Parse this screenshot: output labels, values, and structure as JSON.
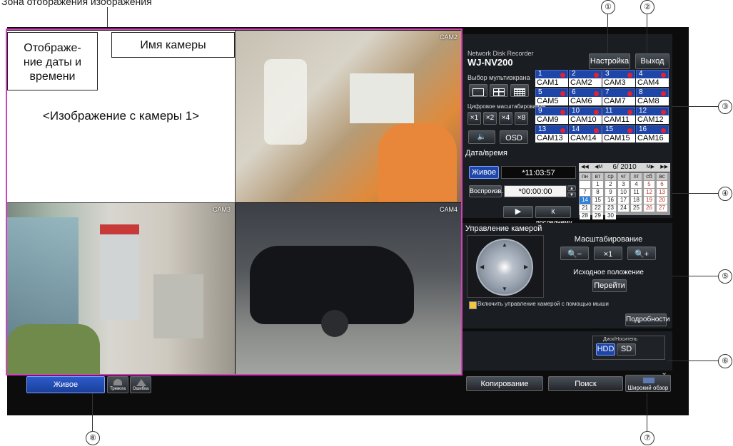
{
  "zone_label": "Зона отображения изображения",
  "annotations": {
    "date_time_label": "Отображе-\nние даты и\nвремени",
    "camera_name_label": "Имя камеры",
    "camera1_image_label": "<Изображение с камеры 1>"
  },
  "cameras": {
    "cam2": "CAM2",
    "cam3": "CAM3",
    "cam4": "CAM4"
  },
  "header": {
    "brand": "Network Disk Recorder",
    "model": "WJ-NV200",
    "setup_label": "Настройка",
    "exit_label": "Выход"
  },
  "multiscreen": {
    "title": "Выбор мультиэкрана",
    "digital_zoom_title": "Цифровое масштабирование",
    "zoom_options": [
      "×1",
      "×2",
      "×4",
      "×8"
    ],
    "osd_label": "OSD",
    "grid": [
      {
        "num": "1",
        "name": "CAM1"
      },
      {
        "num": "2",
        "name": "CAM2"
      },
      {
        "num": "3",
        "name": "CAM3"
      },
      {
        "num": "4",
        "name": "CAM4"
      },
      {
        "num": "5",
        "name": "CAM5"
      },
      {
        "num": "6",
        "name": "CAM6"
      },
      {
        "num": "7",
        "name": "CAM7"
      },
      {
        "num": "8",
        "name": "CAM8"
      },
      {
        "num": "9",
        "name": "CAM9"
      },
      {
        "num": "10",
        "name": "CAM10"
      },
      {
        "num": "11",
        "name": "CAM11"
      },
      {
        "num": "12",
        "name": "CAM12"
      },
      {
        "num": "13",
        "name": "CAM13"
      },
      {
        "num": "14",
        "name": "CAM14"
      },
      {
        "num": "15",
        "name": "CAM15"
      },
      {
        "num": "16",
        "name": "CAM16"
      }
    ]
  },
  "datetime": {
    "title": "Дата/время",
    "live_label": "Живое",
    "live_time": "*11:03:57",
    "playback_label": "Воспроизв.",
    "playback_time": "*00:00:00",
    "last_label": "К последнему",
    "calendar_month": "6/ 2010",
    "weekdays": [
      "пн",
      "вт",
      "ср",
      "чт",
      "пт",
      "сб",
      "вс"
    ],
    "days": [
      "",
      "1",
      "2",
      "3",
      "4",
      "5",
      "6",
      "7",
      "8",
      "9",
      "10",
      "11",
      "12",
      "13",
      "14",
      "15",
      "16",
      "17",
      "18",
      "19",
      "20",
      "21",
      "22",
      "23",
      "24",
      "25",
      "26",
      "27",
      "28",
      "29",
      "30"
    ],
    "selected_day": "14"
  },
  "camera_control": {
    "title": "Управление камерой",
    "zoom_title": "Масштабирование",
    "zoom_x1": "×1",
    "home_title": "Исходное положение",
    "go_label": "Перейти",
    "mouse_checkbox_label": "Включить управление камерой с помощью мыши",
    "details_label": "Подробности"
  },
  "disk": {
    "title": "Диск/Носитель",
    "hdd": "HDD",
    "sd": "SD"
  },
  "bottom": {
    "copy_label": "Копирование",
    "search_label": "Поиск",
    "wide_label": "Широкий обзор",
    "live_label": "Живое",
    "alarm_label": "Тревога",
    "error_label": "Ошибка"
  },
  "callouts": [
    "①",
    "②",
    "③",
    "④",
    "⑤",
    "⑥",
    "⑦",
    "⑧"
  ],
  "colors": {
    "accent_border": "#d43fba",
    "live_blue": "#1d46a8",
    "alarm_red": "#e3212f",
    "today_blue": "#2e7fe0"
  }
}
